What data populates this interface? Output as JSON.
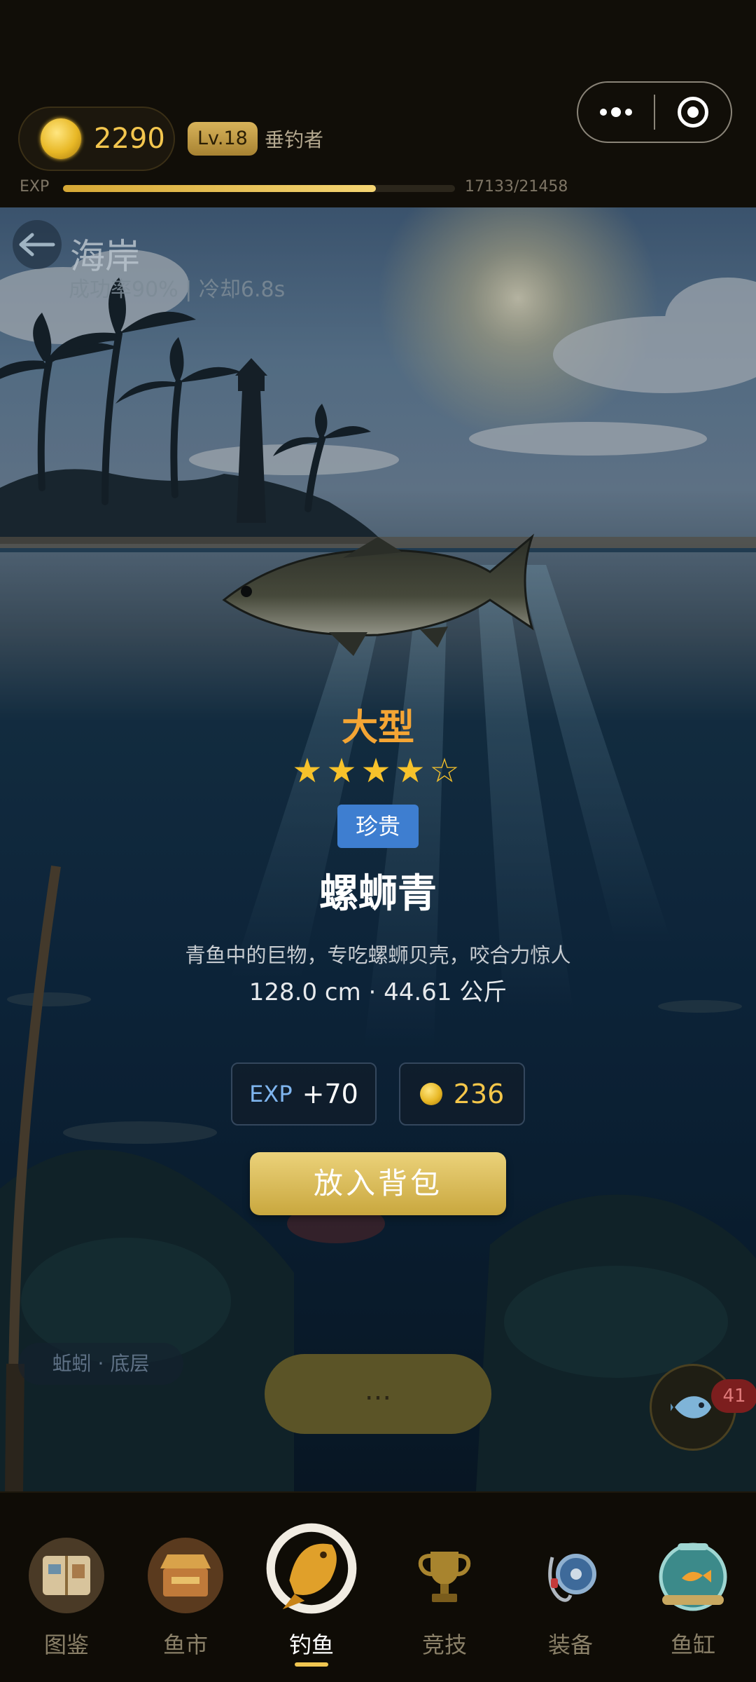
{
  "header": {
    "coins": "2290",
    "level": "Lv.18",
    "rank_title": "垂钓者",
    "exp_label": "EXP",
    "exp_progress": 0.798,
    "exp_text": "17133/21458"
  },
  "location": {
    "title": "海岸",
    "subtitle": "成功率90% | 冷却6.8s"
  },
  "catch": {
    "size": "大型",
    "stars": "★★★★☆",
    "rarity": "珍贵",
    "name": "螺蛳青",
    "description": "青鱼中的巨物，专吃螺蛳贝壳，咬合力惊人",
    "measurements": "128.0 cm · 44.61 公斤",
    "exp_label": "EXP",
    "exp_reward": "+70",
    "coin_reward": "236",
    "put_in_bag": "放入背包"
  },
  "controls": {
    "bait": "蚯蚓 · 底层",
    "cast": "...",
    "tank_count": "41"
  },
  "nav": {
    "items": [
      {
        "label": "图鉴"
      },
      {
        "label": "鱼市"
      },
      {
        "label": "钓鱼"
      },
      {
        "label": "竞技"
      },
      {
        "label": "装备"
      },
      {
        "label": "鱼缸"
      }
    ],
    "active_index": 2
  },
  "colors": {
    "gold": "#f3c64e",
    "size_orange": "#f4a534",
    "rarity_blue": "#3e7ed0",
    "badge_red": "#7c1e1e"
  }
}
